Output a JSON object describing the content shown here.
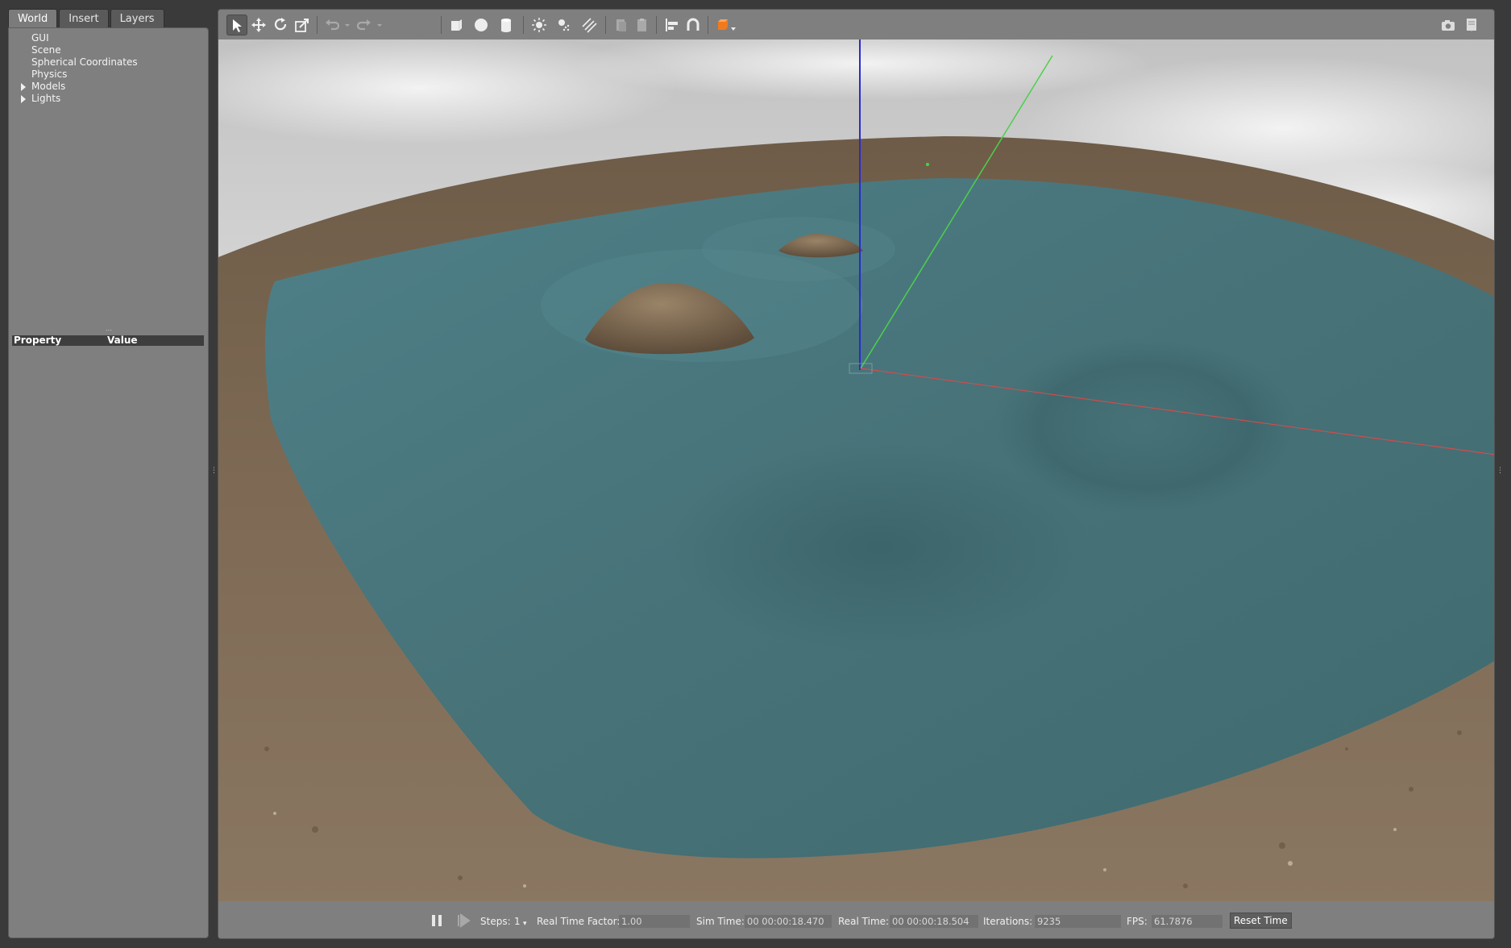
{
  "tabs": [
    {
      "label": "World",
      "active": true
    },
    {
      "label": "Insert",
      "active": false
    },
    {
      "label": "Layers",
      "active": false
    }
  ],
  "tree": [
    {
      "label": "GUI",
      "expandable": false
    },
    {
      "label": "Scene",
      "expandable": false
    },
    {
      "label": "Spherical Coordinates",
      "expandable": false
    },
    {
      "label": "Physics",
      "expandable": false
    },
    {
      "label": "Models",
      "expandable": true
    },
    {
      "label": "Lights",
      "expandable": true
    }
  ],
  "property_table": {
    "col_property": "Property",
    "col_value": "Value"
  },
  "toolbar": {
    "tools": [
      "select-arrow-icon",
      "translate-icon",
      "rotate-icon",
      "scale-icon",
      "undo-icon",
      "undo-dropdown-icon",
      "redo-icon",
      "redo-dropdown-icon",
      "box-icon",
      "sphere-icon",
      "cylinder-icon",
      "point-light-icon",
      "spot-light-icon",
      "directional-light-icon",
      "copy-icon",
      "paste-icon",
      "align-icon",
      "snap-magnet-icon",
      "view-angle-icon",
      "screenshot-camera-icon",
      "log-icon"
    ]
  },
  "status": {
    "steps_label": "Steps:",
    "steps_value": "1",
    "rtf_label": "Real Time Factor:",
    "rtf_value": "1.00",
    "sim_time_label": "Sim Time:",
    "sim_time_value": "00 00:00:18.470",
    "real_time_label": "Real Time:",
    "real_time_value": "00 00:00:18.504",
    "iterations_label": "Iterations:",
    "iterations_value": "9235",
    "fps_label": "FPS:",
    "fps_value": "61.7876",
    "reset_button": "Reset Time"
  },
  "colors": {
    "panel": "#7f7f7f",
    "water": "#4d7a80",
    "sand": "#7f6a52",
    "sky": "#d4d4d4",
    "axis_x": "#d84a4a",
    "axis_y": "#4cd04c",
    "axis_z": "#2a2ad0",
    "view_angle_accent": "#f07a1e"
  }
}
